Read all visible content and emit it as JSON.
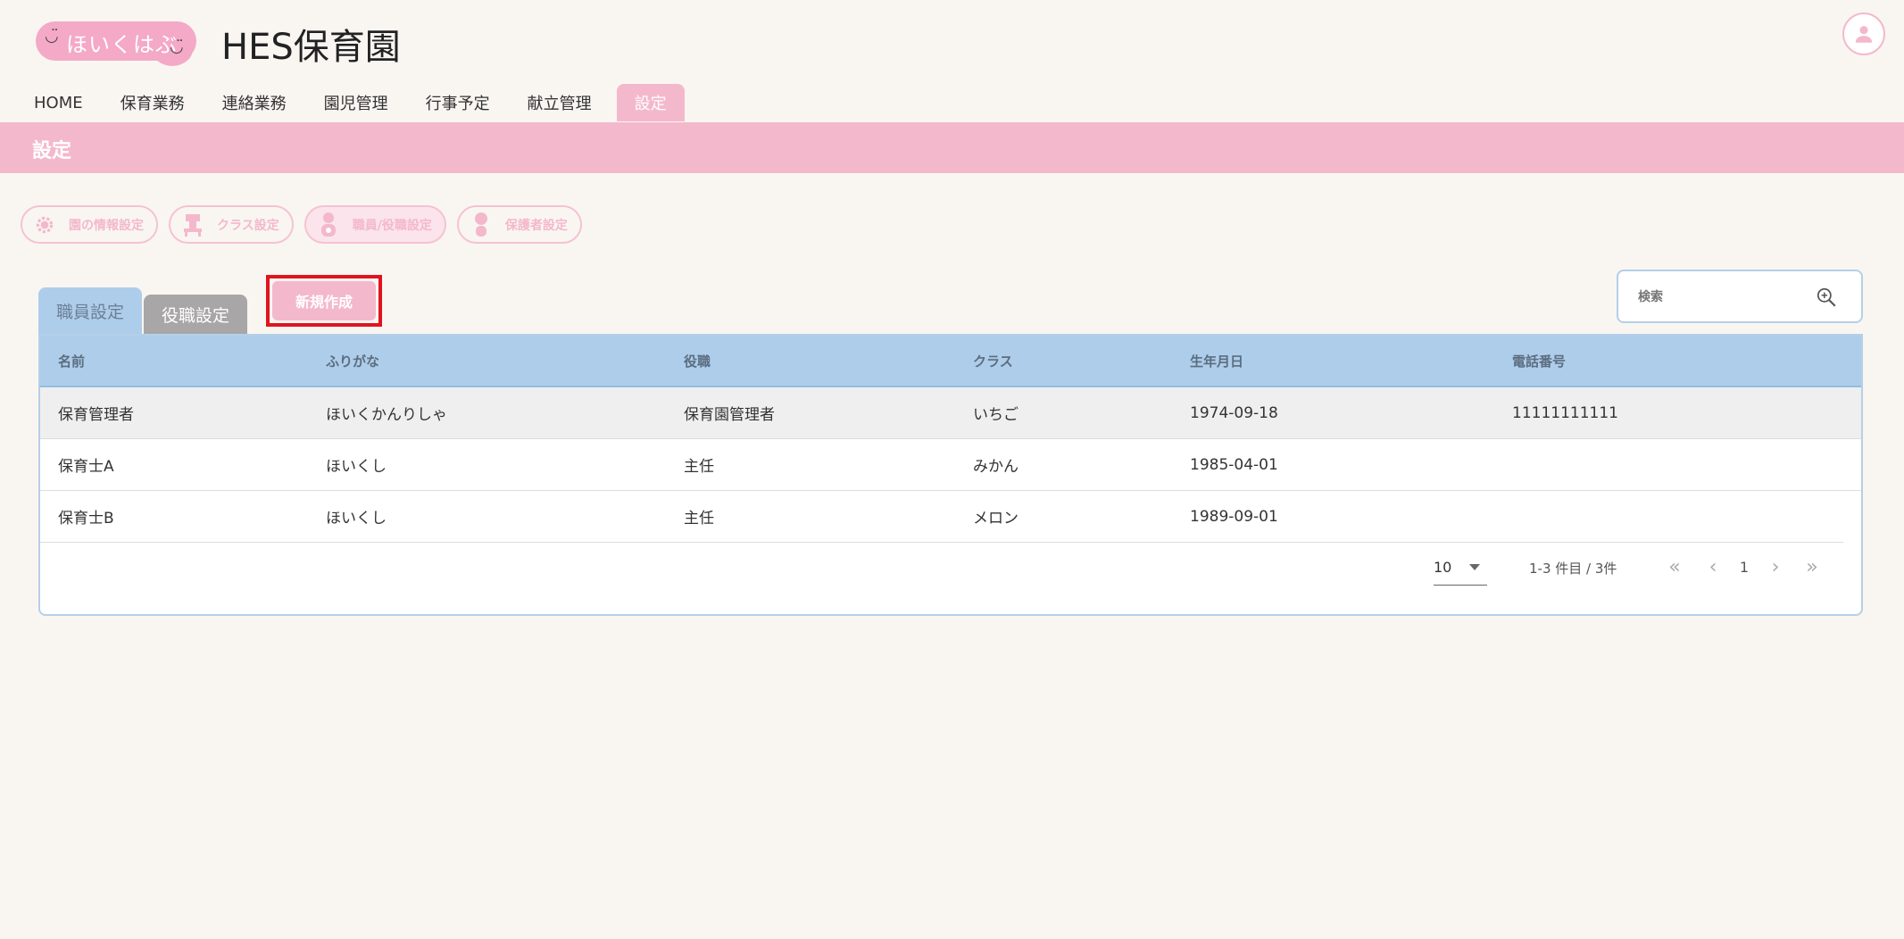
{
  "header": {
    "logo_text": "ほいくはぶ",
    "logo_smile_left": "◡̈",
    "logo_smile_right": "◡̈",
    "site_title": "HES保育園"
  },
  "nav": {
    "items": [
      {
        "label": "HOME"
      },
      {
        "label": "保育業務"
      },
      {
        "label": "連絡業務"
      },
      {
        "label": "園児管理"
      },
      {
        "label": "行事予定"
      },
      {
        "label": "献立管理"
      },
      {
        "label": "設定"
      }
    ],
    "active_index": 6
  },
  "page": {
    "title": "設定"
  },
  "subnav": {
    "items": [
      {
        "label": "園の情報設定",
        "icon": "gear-icon"
      },
      {
        "label": "クラス設定",
        "icon": "class-icon"
      },
      {
        "label": "職員/役職設定",
        "icon": "staff-icon"
      },
      {
        "label": "保護者設定",
        "icon": "parent-icon"
      }
    ],
    "active_index": 2
  },
  "tabs": {
    "staff": "職員設定",
    "role": "役職設定"
  },
  "new_button": "新規作成",
  "search": {
    "placeholder": "検索"
  },
  "table": {
    "headers": [
      "名前",
      "ふりがな",
      "役職",
      "クラス",
      "生年月日",
      "電話番号"
    ],
    "rows": [
      [
        "保育管理者",
        "ほいくかんりしゃ",
        "保育園管理者",
        "いちご",
        "1974-09-18",
        "11111111111"
      ],
      [
        "保育士A",
        "ほいくし",
        "主任",
        "みかん",
        "1985-04-01",
        ""
      ],
      [
        "保育士B",
        "ほいくし",
        "主任",
        "メロン",
        "1989-09-01",
        ""
      ]
    ]
  },
  "pagination": {
    "per_page": "10",
    "range_text": "1-3 件目 / 3件",
    "current_page": "1"
  },
  "colors": {
    "pink": "#f4b8cc",
    "blue_header": "#aecdea",
    "highlight_red": "#e0141e"
  }
}
